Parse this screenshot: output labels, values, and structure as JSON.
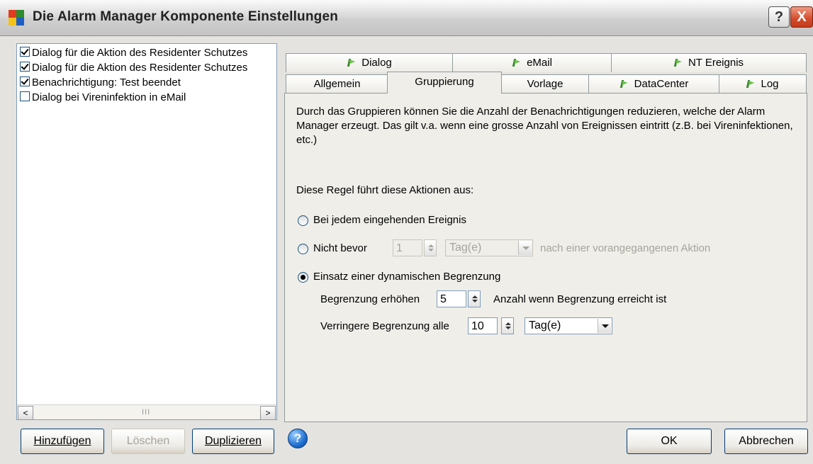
{
  "window": {
    "title": "Die Alarm Manager Komponente Einstellungen",
    "help_button": "?",
    "close_button": "X"
  },
  "rules_list": [
    {
      "label": "Dialog für die Aktion des Residenter Schutzes",
      "checked": true
    },
    {
      "label": "Dialog für die Aktion des Residenter Schutzes",
      "checked": true
    },
    {
      "label": "Benachrichtigung: Test beendet",
      "checked": true
    },
    {
      "label": "Dialog bei Vireninfektion in eMail",
      "checked": false
    }
  ],
  "scrollbar": {
    "left": "<",
    "right": ">",
    "grip": "III"
  },
  "left_buttons": {
    "add": "Hinzufügen",
    "delete": "Löschen",
    "duplicate": "Duplizieren"
  },
  "tabs": {
    "row1": [
      "Dialog",
      "eMail",
      "NT Ereignis"
    ],
    "row2": [
      "Allgemein",
      "Gruppierung",
      "Vorlage",
      "DataCenter",
      "Log"
    ],
    "active": "Gruppierung"
  },
  "grouping": {
    "description": "Durch das Gruppieren können Sie die Anzahl der Benachrichtigungen reduzieren, welche der Alarm Manager erzeugt. Das gilt v.a. wenn eine grosse Anzahl von Ereignissen eintritt (z.B. bei Vireninfektionen, etc.)",
    "rule_label": "Diese Regel führt diese Aktionen aus:",
    "option_each": "Bei jedem eingehenden Ereignis",
    "option_not_before": "Nicht bevor",
    "not_before_value": "1",
    "not_before_unit": "Tag(e)",
    "not_before_suffix": "nach einer vorangegangenen Aktion",
    "option_dynamic": "Einsatz einer dynamischen Begrenzung",
    "selected_option": "dynamic",
    "increase_label": "Begrenzung erhöhen",
    "increase_value": "5",
    "increase_suffix": "Anzahl wenn Begrenzung erreicht ist",
    "decrease_label": "Verringere Begrenzung alle",
    "decrease_value": "10",
    "decrease_unit": "Tag(e)"
  },
  "footer": {
    "help_icon": "?",
    "ok": "OK",
    "cancel": "Abbrechen"
  }
}
